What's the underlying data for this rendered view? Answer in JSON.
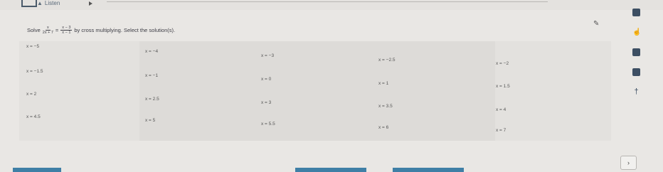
{
  "toolbar": {
    "listen_label": "Listen",
    "speaker_icon": "speaker-icon",
    "play_icon": "play-icon"
  },
  "prompt": {
    "before": "Solve",
    "frac1": {
      "num": "x",
      "den": "2x + 7"
    },
    "equals": "=",
    "frac2": {
      "num": "x − 3",
      "den": "x − 1"
    },
    "after": "by cross multiplying. Select the solution(s)."
  },
  "options": [
    "x = −5",
    "x = −4",
    "x = −3",
    "x = −2.5",
    "x = −2",
    "x = −1.5",
    "x = −1",
    "x = 0",
    "x = 1",
    "x = 1.5",
    "x = 2",
    "x = 2.5",
    "x = 3",
    "x = 3.5",
    "x = 4",
    "x = 4.5",
    "x = 5",
    "x = 5.5",
    "x = 6",
    "x = 7"
  ],
  "nav": {
    "next_label": "›"
  },
  "colors": {
    "accent": "#3f7fa6"
  }
}
